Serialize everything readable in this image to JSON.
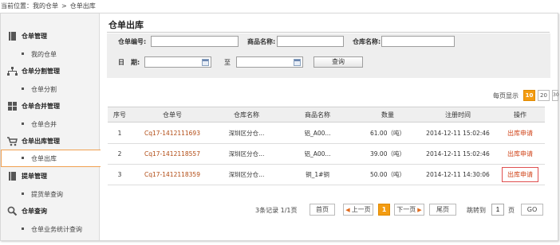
{
  "breadcrumb": {
    "prefix": "当前位置：",
    "level1": "我的仓单",
    "separator": ">",
    "level2": "仓单出库"
  },
  "sidebar": {
    "groups": [
      {
        "label": "仓单管理",
        "icon": "book-icon",
        "items": [
          "我的仓单"
        ]
      },
      {
        "label": "仓单分割管理",
        "icon": "split-tree-icon",
        "items": [
          "仓单分割"
        ]
      },
      {
        "label": "仓单合并管理",
        "icon": "grid-merge-icon",
        "items": [
          "仓单合并"
        ]
      },
      {
        "label": "仓单出库管理",
        "icon": "cart-icon",
        "items": [
          "仓单出库"
        ]
      },
      {
        "label": "提单管理",
        "icon": "book-icon",
        "items": [
          "提货单查询"
        ]
      },
      {
        "label": "仓单查询",
        "icon": "search-icon",
        "items": [
          "仓单业务统计查询"
        ]
      }
    ],
    "active_item": "仓单出库"
  },
  "page_title": "仓单出库",
  "search": {
    "warrant_no_label": "仓单编号:",
    "warrant_no_value": "",
    "product_label": "商品名称:",
    "product_value": "",
    "warehouse_label": "仓库名称:",
    "warehouse_value": "",
    "date_label": "日　期:",
    "date_from": "",
    "date_to_label": "至",
    "date_to": "",
    "query_button": "查询"
  },
  "page_size": {
    "label": "每页显示",
    "options": [
      "10",
      "20",
      "30"
    ],
    "selected": "10"
  },
  "table": {
    "headers": [
      "序号",
      "仓单号",
      "仓库名称",
      "商品名称",
      "数量",
      "注册时间",
      "操作"
    ],
    "rows": [
      {
        "no": "1",
        "warrant": "Cq17-1412111693",
        "warehouse": "深圳区分仓...",
        "product": "铝_A00...",
        "qty": "61.00（吨）",
        "time": "2014-12-11 15:02:46",
        "op": "出库申请"
      },
      {
        "no": "2",
        "warrant": "Cq17-1412118557",
        "warehouse": "深圳区分仓...",
        "product": "铝_A00...",
        "qty": "39.00（吨）",
        "time": "2014-12-11 15:02:46",
        "op": "出库申请"
      },
      {
        "no": "3",
        "warrant": "Cq17-1412118359",
        "warehouse": "深圳区分仓...",
        "product": "铜_1#铜",
        "qty": "50.00（吨）",
        "time": "2014-12-11 14:30:06",
        "op": "出库申请"
      }
    ]
  },
  "pagination": {
    "summary": "3条记录 1/1页",
    "first": "首页",
    "prev": "上一页",
    "current": "1",
    "next": "下一页",
    "last": "尾页",
    "jump_label": "跳转到",
    "jump_value": "1",
    "page_unit": "页",
    "go": "GO"
  },
  "colors": {
    "accent": "#f39c12",
    "link": "#b14a12",
    "highlight_border": "#f0a050"
  }
}
